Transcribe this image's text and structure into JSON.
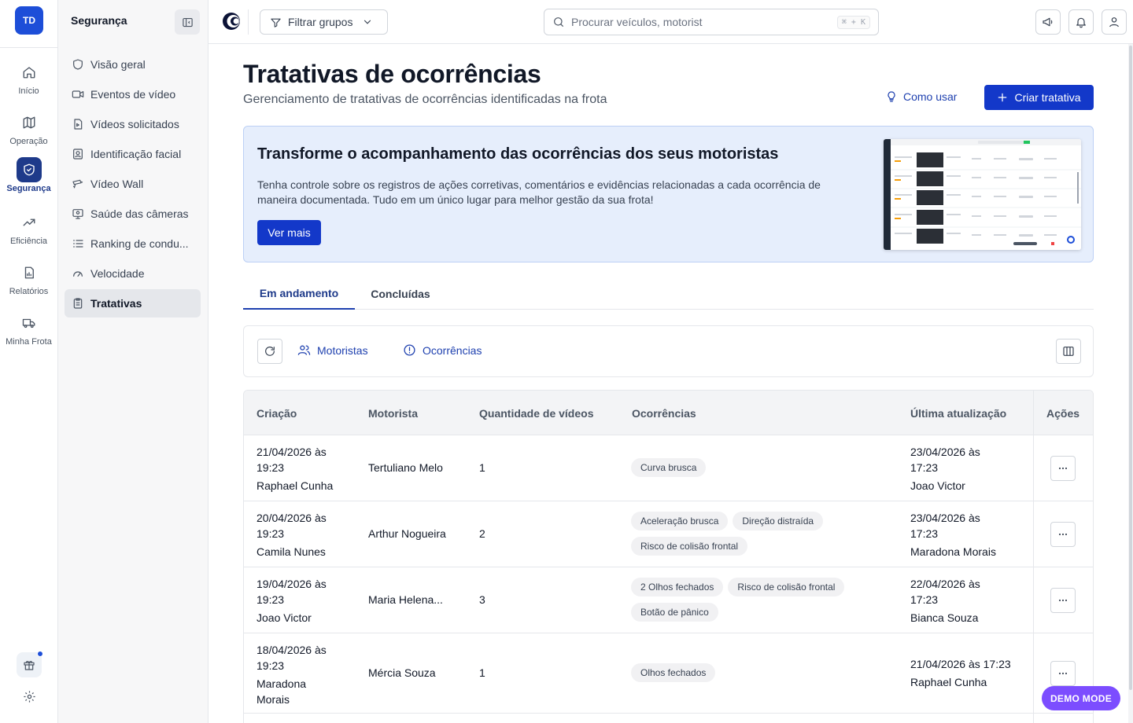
{
  "rail": {
    "avatar": "TD",
    "items": [
      {
        "label": "Início",
        "icon": "home-icon"
      },
      {
        "label": "Operação",
        "icon": "map-icon"
      },
      {
        "label": "Segurança",
        "icon": "shield-icon",
        "active": true
      },
      {
        "label": "Eficiência",
        "icon": "trending-up-icon"
      },
      {
        "label": "Relatórios",
        "icon": "report-icon"
      },
      {
        "label": "Minha Frota",
        "icon": "truck-icon"
      }
    ]
  },
  "sidebar": {
    "title": "Segurança",
    "items": [
      {
        "label": "Visão geral",
        "icon": "shield-outline-icon"
      },
      {
        "label": "Eventos de vídeo",
        "icon": "video-icon"
      },
      {
        "label": "Vídeos solicitados",
        "icon": "file-video-icon"
      },
      {
        "label": "Identificação facial",
        "icon": "face-id-icon"
      },
      {
        "label": "Vídeo Wall",
        "icon": "video-wall-icon"
      },
      {
        "label": "Saúde das câmeras",
        "icon": "monitor-icon"
      },
      {
        "label": "Ranking de condu...",
        "icon": "list-icon"
      },
      {
        "label": "Velocidade",
        "icon": "gauge-icon"
      },
      {
        "label": "Tratativas",
        "icon": "clipboard-icon",
        "active": true
      }
    ]
  },
  "topbar": {
    "filter_label": "Filtrar grupos",
    "search_placeholder": "Procurar veículos, motorist",
    "shortcut": "⌘ + K"
  },
  "page": {
    "title": "Tratativas de ocorrências",
    "subtitle": "Gerenciamento de tratativas de ocorrências identificadas na frota",
    "how_to_label": "Como usar",
    "create_label": "Criar tratativa"
  },
  "banner": {
    "title": "Transforme o acompanhamento das ocorrências dos seus motoristas",
    "text": "Tenha controle sobre os registros de ações corretivas, comentários e evidências relacionadas a cada ocorrência de maneira documentada. Tudo em um único lugar para melhor gestão da sua frota!",
    "button": "Ver mais"
  },
  "tabs": [
    {
      "label": "Em andamento",
      "active": true
    },
    {
      "label": "Concluídas"
    }
  ],
  "toolbar": {
    "drivers_label": "Motoristas",
    "occurrences_label": "Ocorrências"
  },
  "table": {
    "headers": {
      "created": "Criação",
      "driver": "Motorista",
      "videos": "Quantidade de vídeos",
      "occurrences": "Ocorrências",
      "updated": "Última atualização",
      "actions": "Ações"
    },
    "rows": [
      {
        "created_date": "21/04/2026 às",
        "created_time": "19:23",
        "created_by": "Raphael Cunha",
        "driver": "Tertuliano Melo",
        "videos": "1",
        "occurrences": [
          "Curva brusca"
        ],
        "updated_date": "23/04/2026 às",
        "updated_time": "17:23",
        "updated_by": "Joao Victor"
      },
      {
        "created_date": "20/04/2026 às",
        "created_time": "19:23",
        "created_by": "Camila Nunes",
        "driver": "Arthur Nogueira",
        "videos": "2",
        "occurrences": [
          "Aceleração brusca",
          "Direção distraída",
          "Risco de colisão frontal"
        ],
        "updated_date": "23/04/2026 às",
        "updated_time": "17:23",
        "updated_by": "Maradona Morais"
      },
      {
        "created_date": "19/04/2026 às",
        "created_time": "19:23",
        "created_by": "Joao Victor",
        "driver": "Maria Helena...",
        "videos": "3",
        "occurrences": [
          "2 Olhos fechados",
          "Risco de colisão frontal",
          "Botão de pânico"
        ],
        "updated_date": "22/04/2026 às",
        "updated_time": "17:23",
        "updated_by": "Bianca Souza"
      },
      {
        "created_date": "18/04/2026 às",
        "created_time": "19:23",
        "created_by_1": "Maradona",
        "created_by_2": "Morais",
        "driver": "Mércia Souza",
        "videos": "1",
        "occurrences": [
          "Olhos fechados"
        ],
        "updated_date": "21/04/2026 às 17:23",
        "updated_by": "Raphael Cunha"
      }
    ]
  },
  "demo_badge": "DEMO MODE",
  "colors": {
    "primary": "#1338c9",
    "nav_active": "#1e3a8a",
    "banner_bg": "#e6eefc",
    "demo": "#7c4dff"
  }
}
